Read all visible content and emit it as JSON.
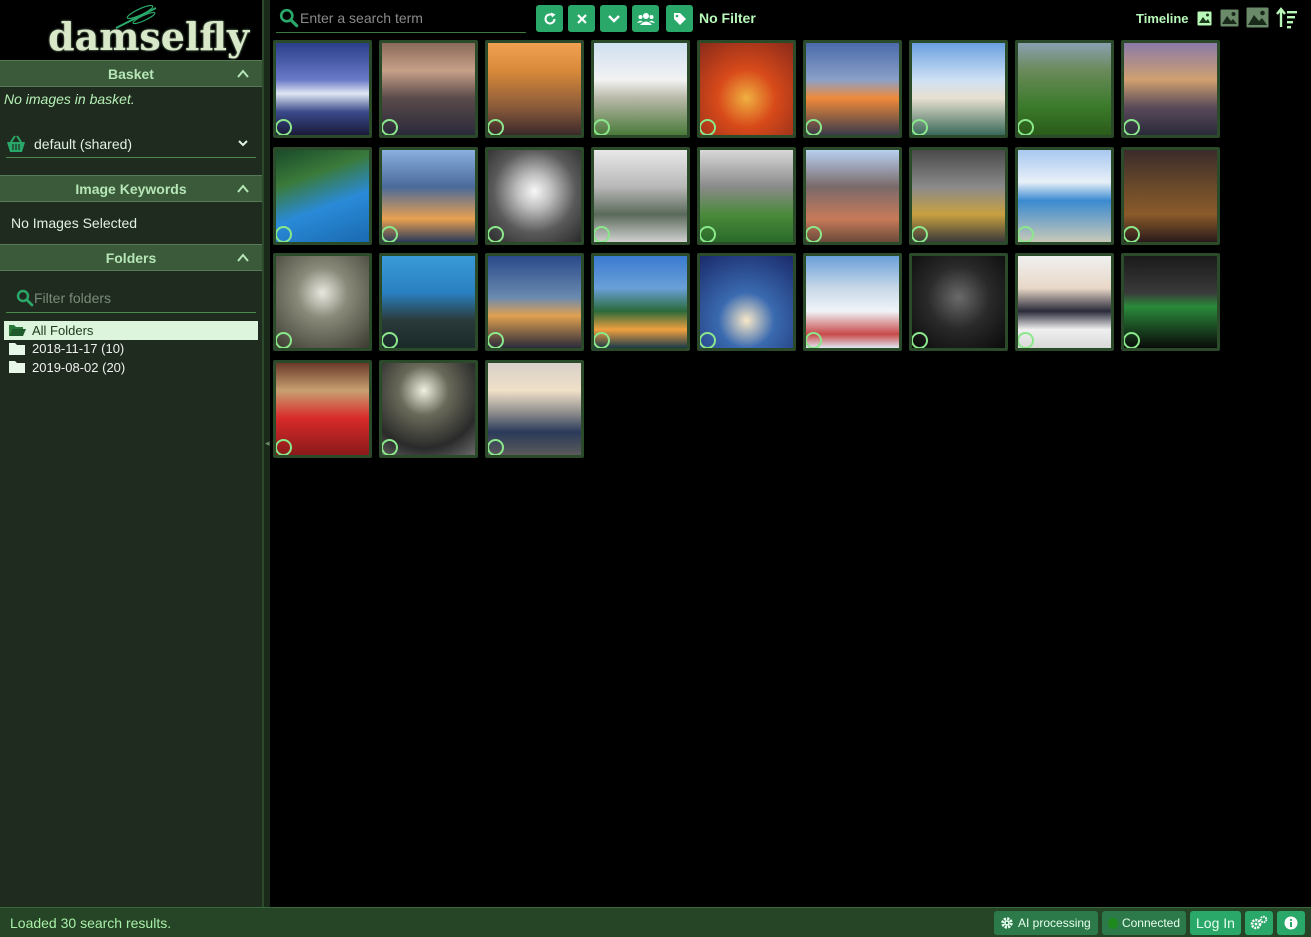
{
  "app": {
    "logo_text": "damselfly"
  },
  "basket": {
    "title": "Basket",
    "empty_text": "No images in basket.",
    "selected_basket": "default (shared)"
  },
  "keywords": {
    "title": "Image Keywords",
    "empty_text": "No Images Selected"
  },
  "folders": {
    "title": "Folders",
    "filter_placeholder": "Filter folders",
    "items": [
      {
        "label": "All Folders"
      },
      {
        "label": "2018-11-17 (10)"
      },
      {
        "label": "2019-08-02 (20)"
      }
    ]
  },
  "toolbar": {
    "search_placeholder": "Enter a search term",
    "filter_text": "No Filter",
    "timeline_label": "Timeline"
  },
  "status": {
    "message": "Loaded 30 search results.",
    "ai_label": "AI processing",
    "connected_label": "Connected",
    "login_label": "Log In"
  },
  "colors": {
    "accent": "#2aa86a",
    "sidebar_bg": "#1e2b1e",
    "header_bg": "#3a5a3a",
    "status_bg": "#264426"
  },
  "thumbnails": [
    {
      "name": "mountain-night-lake",
      "bg": "linear-gradient(180deg,#2a3f8a 0%,#6a7ac8 40%,#dfe6f2 55%,#3a4a8a 75%,#1a1a3a 100%)"
    },
    {
      "name": "lighthouse-rocks",
      "bg": "linear-gradient(180deg,#8a6a5a 0%,#c8a088 30%,#5a4a4a 60%,#2a2a3a 100%)"
    },
    {
      "name": "golden-peaks",
      "bg": "linear-gradient(180deg,#f0a050 0%,#d88a3a 30%,#8a5a3a 70%,#3a2a2a 100%)"
    },
    {
      "name": "castle-neuschwanstein",
      "bg": "linear-gradient(180deg,#cfe0f0 0%,#f2f2f2 40%,#b8b8a8 60%,#4a7a3a 100%)"
    },
    {
      "name": "red-gate-arch",
      "bg": "radial-gradient(circle at 50% 60%,#f0b040 0%,#d84a1a 40%,#8a2a1a 100%)"
    },
    {
      "name": "highway-interchange",
      "bg": "linear-gradient(180deg,#4a6aaa 0%,#8aa0c8 40%,#f08a3a 60%,#3a3a4a 100%)"
    },
    {
      "name": "taj-mahal",
      "bg": "linear-gradient(180deg,#6aa0e0 0%,#cfe0f5 40%,#e8e0d0 60%,#3a6a5a 100%)"
    },
    {
      "name": "green-valley",
      "bg": "linear-gradient(180deg,#8aa0b0 0%,#6a8a5a 30%,#3a7a2a 70%,#2a5a1a 100%)"
    },
    {
      "name": "city-skyline-dusk",
      "bg": "linear-gradient(180deg,#8a7aa8 0%,#d0a070 40%,#5a4a5a 70%,#2a2a3a 100%)"
    },
    {
      "name": "aerial-coast",
      "bg": "linear-gradient(160deg,#1a4a2a 0%,#3a7a3a 30%,#2a8ad8 60%,#1a6ab0 100%)"
    },
    {
      "name": "twin-towers",
      "bg": "linear-gradient(180deg,#8ab0e0 0%,#4a6a9a 40%,#e8a050 75%,#2a3a5a 100%)"
    },
    {
      "name": "concrete-tunnel",
      "bg": "radial-gradient(circle at 50% 45%,#f8f8f8 0%,#bfbfbf 25%,#5a5a5a 60%,#2a2a2a 100%)"
    },
    {
      "name": "plant-chair",
      "bg": "linear-gradient(180deg,#e8e8e8 0%,#b8b8b8 40%,#5a6a5a 70%,#d0d0d0 100%)"
    },
    {
      "name": "soccer-player",
      "bg": "linear-gradient(180deg,#d8d8d8 0%,#8a8a8a 40%,#4a8a3a 70%,#2a6a2a 100%)"
    },
    {
      "name": "prague-church",
      "bg": "linear-gradient(180deg,#b8d0f0 0%,#7a6a6a 40%,#c87a5a 75%,#6a4a3a 100%)"
    },
    {
      "name": "office-lounge",
      "bg": "linear-gradient(180deg,#4a4a4a 0%,#8a8a8a 40%,#c8a040 70%,#3a3a3a 100%)"
    },
    {
      "name": "blue-van",
      "bg": "linear-gradient(180deg,#a8c8f0 0%,#e8f0f8 35%,#3a8ad0 55%,#c8c8b8 100%)"
    },
    {
      "name": "leopard-suit",
      "bg": "linear-gradient(180deg,#3a2a2a 0%,#6a4a2a 40%,#8a5a2a 70%,#2a1a1a 100%)"
    },
    {
      "name": "white-peonies",
      "bg": "radial-gradient(circle at 50% 40%,#e8e8e0 0%,#8a8a7a 35%,#3a3a30 100%)"
    },
    {
      "name": "woman-portrait",
      "bg": "linear-gradient(180deg,#3a9ad8 0%,#2a80c0 40%,#2a3a3a 70%,#1a2a2a 100%)"
    },
    {
      "name": "bridge-lights",
      "bg": "linear-gradient(180deg,#2a4a8a 0%,#6a8ab0 45%,#e0a050 65%,#2a2a3a 100%)"
    },
    {
      "name": "arched-bridge-night",
      "bg": "linear-gradient(180deg,#3a7ad0 0%,#6aa0d8 35%,#2a6a3a 60%,#f0a040 80%,#1a3a4a 100%)"
    },
    {
      "name": "lotus-building-fireworks",
      "bg": "radial-gradient(circle at 50% 70%,#f8e8c8 0%,#3a6ab0 35%,#1a2a6a 100%)"
    },
    {
      "name": "snowy-village",
      "bg": "linear-gradient(180deg,#6aa0d8 0%,#c8d8e8 35%,#f0f4f8 60%,#c84a4a 85%,#e0e8f0 100%)"
    },
    {
      "name": "basketball-player",
      "bg": "radial-gradient(circle at 50% 45%,#6a6a6a 0%,#2a2a2a 45%,#0a0a0a 100%)"
    },
    {
      "name": "striped-shirt-woman",
      "bg": "linear-gradient(180deg,#f0f0f0 0%,#e8d8c8 35%,#2a2a3a 60%,#f0f0f0 80%,#d8d8d8 100%)"
    },
    {
      "name": "leather-jacket",
      "bg": "linear-gradient(180deg,#1a1a1a 0%,#3a3a3a 40%,#2a8a3a 55%,#0a0a0a 100%)"
    },
    {
      "name": "home-theater",
      "bg": "linear-gradient(180deg,#6a3a2a 0%,#c8a070 30%,#d82a2a 60%,#8a1a1a 100%)"
    },
    {
      "name": "daffodils-vase",
      "bg": "radial-gradient(circle at 45% 30%,#f0f0e0 0%,#6a6a5a 30%,#2a2a2a 70%,#6a6a6a 100%)"
    },
    {
      "name": "car-sunset",
      "bg": "linear-gradient(180deg,#d8d0c8 0%,#f0e0c8 30%,#8a8a8a 55%,#2a3a5a 75%,#5a5a5a 100%)"
    }
  ]
}
